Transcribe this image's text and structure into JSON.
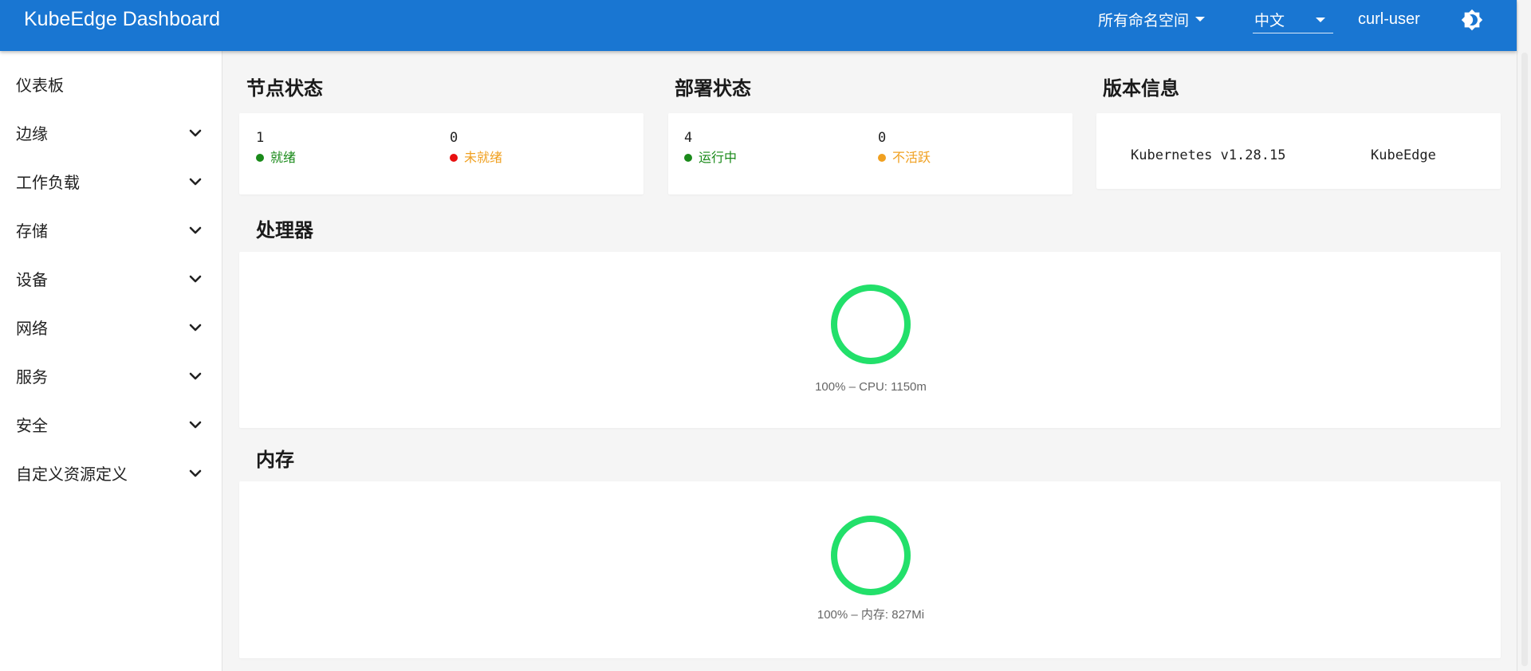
{
  "header": {
    "app_title": "KubeEdge Dashboard",
    "namespace_select": "所有命名空间",
    "language_select": "中文",
    "user": "curl-user",
    "theme_icon": "brightness-icon",
    "colors": {
      "bar": "#1976d2",
      "text": "#ffffff"
    }
  },
  "sidebar": {
    "items": [
      {
        "label": "仪表板",
        "expandable": false
      },
      {
        "label": "边缘",
        "expandable": true
      },
      {
        "label": "工作负载",
        "expandable": true
      },
      {
        "label": "存储",
        "expandable": true
      },
      {
        "label": "设备",
        "expandable": true
      },
      {
        "label": "网络",
        "expandable": true
      },
      {
        "label": "服务",
        "expandable": true
      },
      {
        "label": "安全",
        "expandable": true
      },
      {
        "label": "自定义资源定义",
        "expandable": true
      }
    ]
  },
  "node_status": {
    "title": "节点状态",
    "ready": {
      "value": "1",
      "label": "就绪",
      "color": "#1a8a1a"
    },
    "not_ready": {
      "value": "0",
      "label": "未就绪",
      "color": "#f0a020",
      "dot_color": "#e81010"
    }
  },
  "deployment_status": {
    "title": "部署状态",
    "running": {
      "value": "4",
      "label": "运行中",
      "color": "#1a8a1a"
    },
    "inactive": {
      "value": "0",
      "label": "不活跃",
      "color": "#f0a020"
    }
  },
  "version_info": {
    "title": "版本信息",
    "kubernetes": "Kubernetes v1.28.15",
    "kubeedge": "KubeEdge"
  },
  "cpu": {
    "title": "处理器",
    "percent": 100,
    "caption": "100% – CPU: 1150m",
    "color": "#22e06a"
  },
  "memory": {
    "title": "内存",
    "percent": 100,
    "caption": "100% – 内存: 827Mi",
    "color": "#22e06a"
  }
}
